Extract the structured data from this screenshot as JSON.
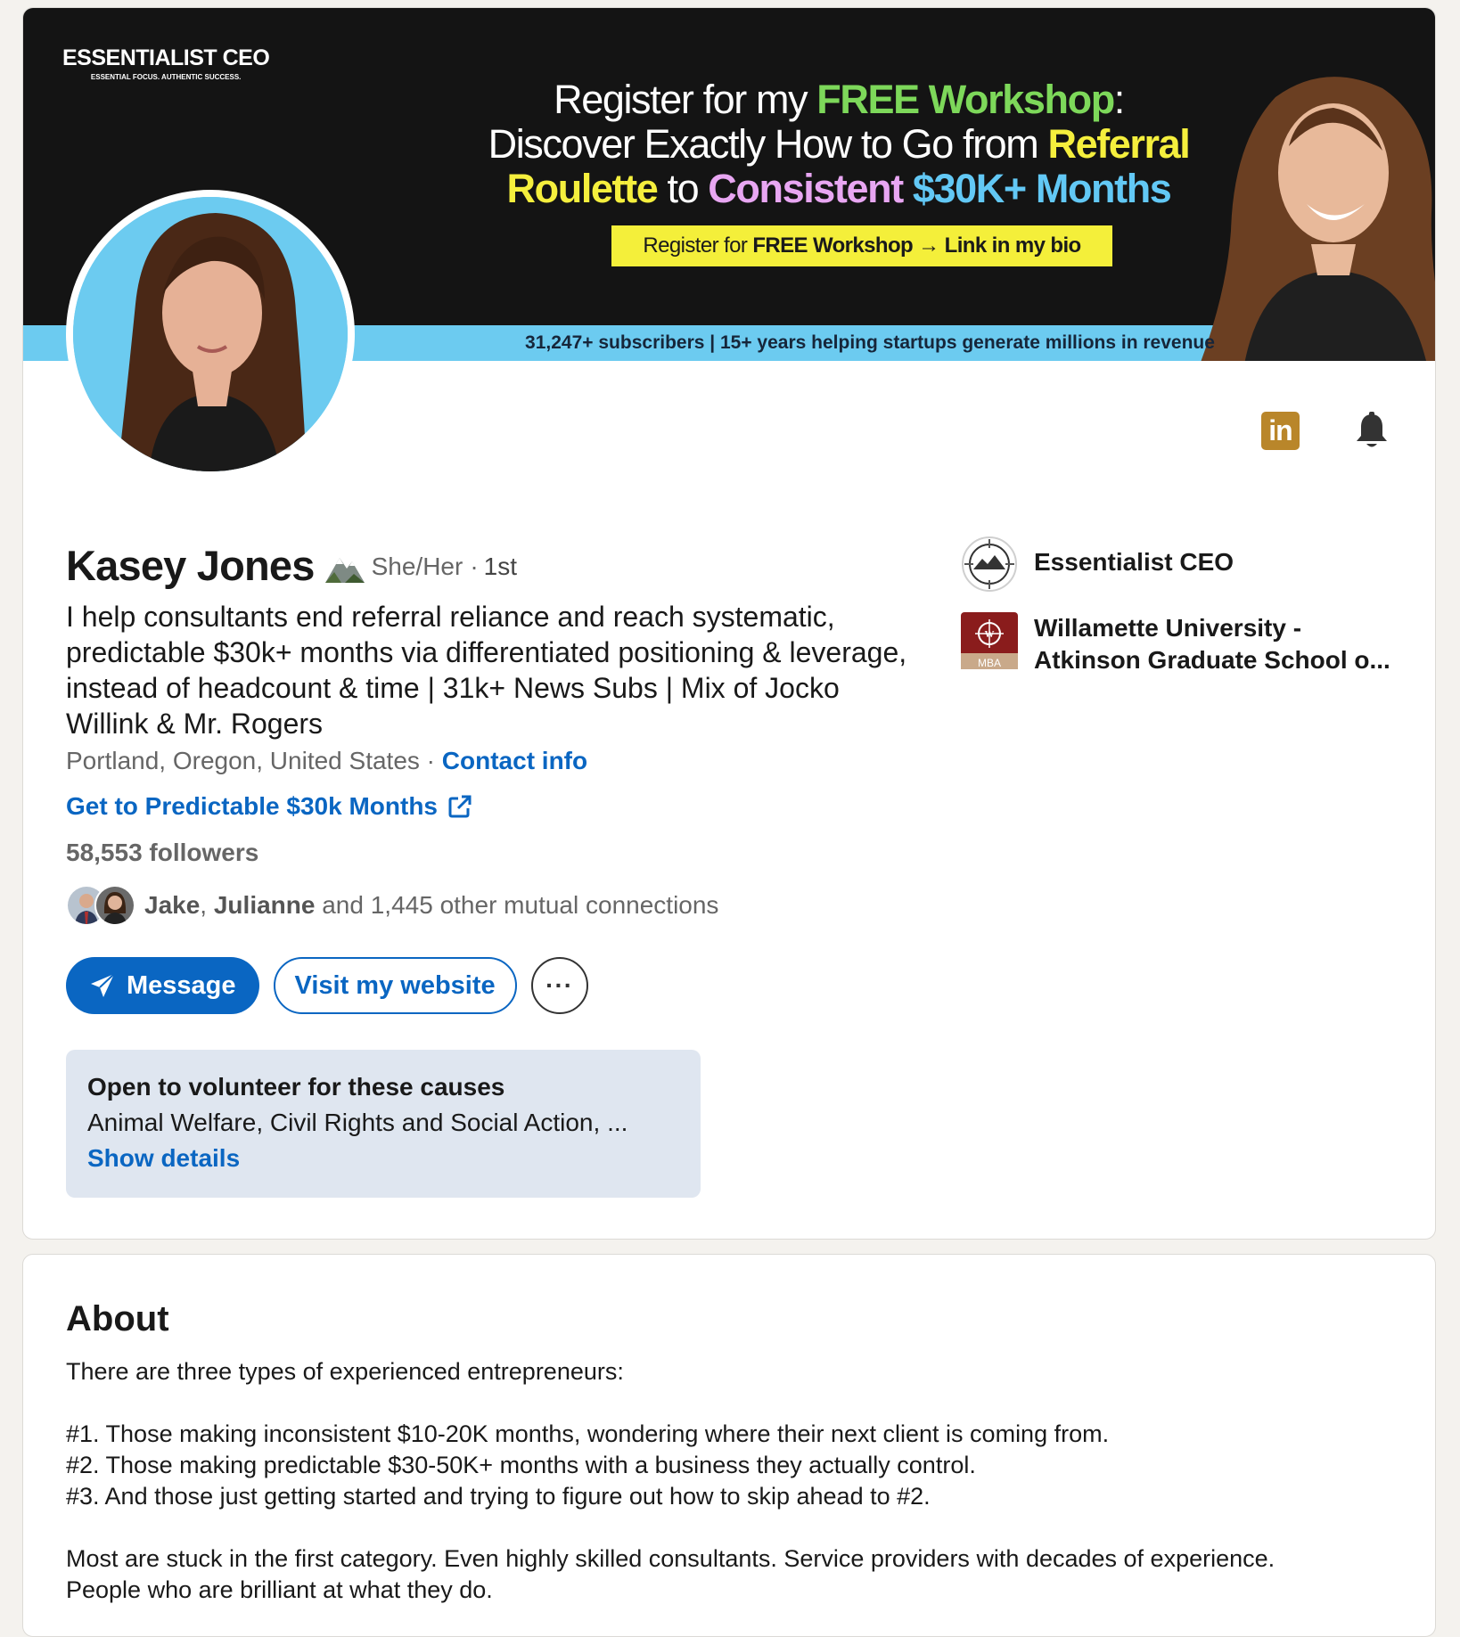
{
  "banner": {
    "brand_name": "ESSENTIALIST CEO",
    "brand_tagline": "ESSENTIAL FOCUS. AUTHENTIC SUCCESS.",
    "headline": {
      "l1_a": "Register for my ",
      "l1_b": "FREE Workshop",
      "l1_c": ":",
      "l2_a": "Discover Exactly How to Go from ",
      "l2_b": "Referral",
      "l3_a": "Roulette",
      "l3_b": " to ",
      "l3_c": "Consistent",
      "l3_d": " $30K+ Months"
    },
    "cta": {
      "a": "Register for ",
      "b": "FREE Workshop",
      "c": " → ",
      "d": "Link in my bio"
    },
    "strip_text": "31,247+ subscribers | 15+ years helping startups generate millions in revenue"
  },
  "profile": {
    "name": "Kasey Jones",
    "pronouns": "She/Her",
    "degree_sep": "·",
    "degree": "1st",
    "headline": "I help consultants end referral reliance and reach systematic, predictable $30k+ months via differentiated positioning & leverage, instead of headcount & time | 31k+ News Subs | Mix of Jocko Willink & Mr. Rogers",
    "location": "Portland, Oregon, United States",
    "location_sep": " · ",
    "contact_info": "Contact info",
    "website_link": "Get to Predictable $30k Months",
    "followers": "58,553 followers",
    "mutual": {
      "name1": "Jake",
      "sep": ", ",
      "name2": "Julianne",
      "rest": " and 1,445 other mutual connections"
    },
    "buttons": {
      "message": "Message",
      "visit": "Visit my website",
      "more": "···"
    },
    "volunteer": {
      "title": "Open to volunteer for these causes",
      "body": "Animal Welfare, Civil Rights and Social Action, ...",
      "link": "Show details"
    },
    "orgs": [
      {
        "name": "Essentialist CEO"
      },
      {
        "name": "Willamette University - Atkinson Graduate School o...",
        "logo_text": "MBA"
      }
    ],
    "icons": {
      "linkedin": "in"
    }
  },
  "about": {
    "title": "About",
    "lines": [
      "There are three types of experienced entrepreneurs:",
      "#1. Those making inconsistent $10-20K months, wondering where their next client is coming from.",
      "#2. Those making predictable $30-50K+ months with a business they actually control.",
      "#3. And those just getting started and trying to figure out how to skip ahead to #2.",
      "Most are stuck in the first category. Even highly skilled consultants. Service providers with decades of experience.",
      "People who are brilliant at what they do."
    ]
  },
  "colors": {
    "accent": "#0a66c2",
    "banner_bg": "#141414",
    "banner_strip": "#6ccbf0",
    "cta_yellow": "#f4ef3a",
    "volunteer_bg": "#dfe6f0",
    "linkedin_gold": "#b9862a"
  }
}
